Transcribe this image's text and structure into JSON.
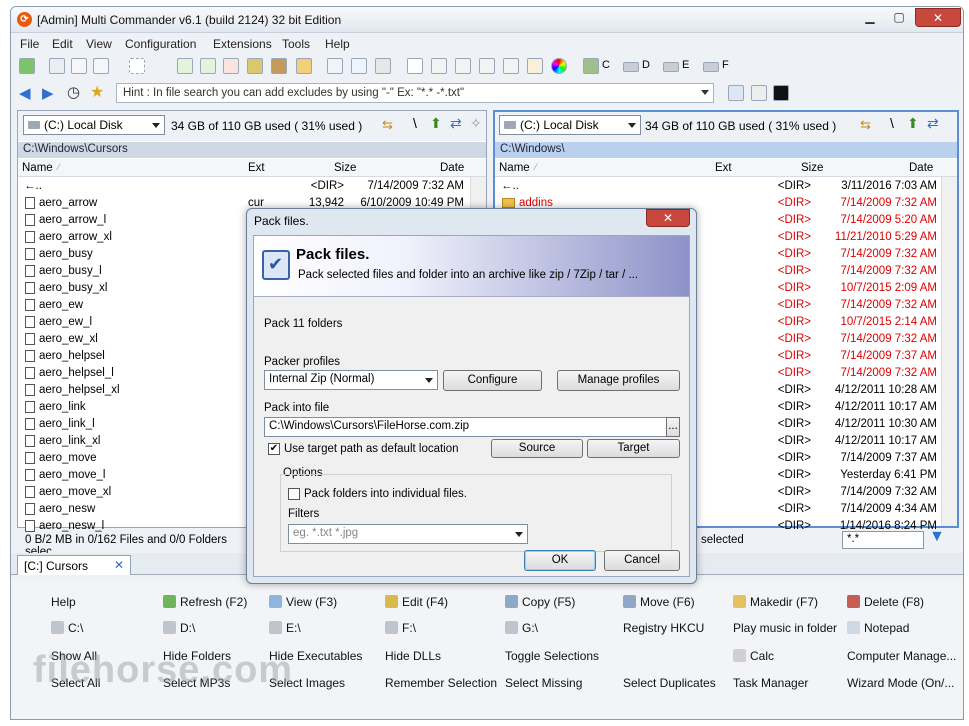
{
  "window": {
    "title": "[Admin] Multi Commander v6.1 (build 2124) 32 bit Edition",
    "app_icon": "multi-commander-icon"
  },
  "menu": [
    "File",
    "Edit",
    "View",
    "Configuration",
    "Extensions",
    "Tools",
    "Help"
  ],
  "toolbar": {
    "drive_labels": [
      "C",
      "D",
      "E",
      "F"
    ]
  },
  "hint": {
    "text": "Hint : In file search you can add excludes by using \"-\" Ex: \"*.* -*.txt\""
  },
  "left_panel": {
    "drive": "(C:) Local Disk",
    "usage": "34 GB of 110 GB used ( 31% used )",
    "path": "C:\\Windows\\Cursors",
    "columns": [
      "Name",
      "Ext",
      "Size",
      "Date"
    ],
    "rows": [
      {
        "name": "←..",
        "ext": "",
        "size": "<DIR>",
        "date": "7/14/2009 7:32 AM"
      },
      {
        "name": "aero_arrow",
        "ext": "cur",
        "size": "13,942",
        "date": "6/10/2009 10:49 PM"
      },
      {
        "name": "aero_arrow_l",
        "ext": "",
        "size": "",
        "date": ""
      },
      {
        "name": "aero_arrow_xl",
        "ext": "",
        "size": "",
        "date": ""
      },
      {
        "name": "aero_busy",
        "ext": "",
        "size": "",
        "date": ""
      },
      {
        "name": "aero_busy_l",
        "ext": "",
        "size": "",
        "date": ""
      },
      {
        "name": "aero_busy_xl",
        "ext": "",
        "size": "",
        "date": ""
      },
      {
        "name": "aero_ew",
        "ext": "",
        "size": "",
        "date": ""
      },
      {
        "name": "aero_ew_l",
        "ext": "",
        "size": "",
        "date": ""
      },
      {
        "name": "aero_ew_xl",
        "ext": "",
        "size": "",
        "date": ""
      },
      {
        "name": "aero_helpsel",
        "ext": "",
        "size": "",
        "date": ""
      },
      {
        "name": "aero_helpsel_l",
        "ext": "",
        "size": "",
        "date": ""
      },
      {
        "name": "aero_helpsel_xl",
        "ext": "",
        "size": "",
        "date": ""
      },
      {
        "name": "aero_link",
        "ext": "",
        "size": "",
        "date": ""
      },
      {
        "name": "aero_link_l",
        "ext": "",
        "size": "",
        "date": ""
      },
      {
        "name": "aero_link_xl",
        "ext": "",
        "size": "",
        "date": ""
      },
      {
        "name": "aero_move",
        "ext": "",
        "size": "",
        "date": ""
      },
      {
        "name": "aero_move_l",
        "ext": "",
        "size": "",
        "date": ""
      },
      {
        "name": "aero_move_xl",
        "ext": "",
        "size": "",
        "date": ""
      },
      {
        "name": "aero_nesw",
        "ext": "",
        "size": "",
        "date": ""
      },
      {
        "name": "aero_nesw_l",
        "ext": "",
        "size": "",
        "date": ""
      }
    ],
    "status": "0 B/2 MB in 0/162 Files and 0/0 Folders selec"
  },
  "right_panel": {
    "drive": "(C:) Local Disk",
    "usage": "34 GB of 110 GB used ( 31% used )",
    "path": "C:\\Windows\\",
    "columns": [
      "Name",
      "Ext",
      "Size",
      "Date"
    ],
    "rows": [
      {
        "name": "←..",
        "size": "<DIR>",
        "date": "3/11/2016 7:03 AM",
        "red": false
      },
      {
        "name": "addins",
        "size": "<DIR>",
        "date": "7/14/2009 7:32 AM",
        "red": true
      },
      {
        "name": "",
        "size": "<DIR>",
        "date": "7/14/2009 5:20 AM",
        "red": true
      },
      {
        "name": "",
        "size": "<DIR>",
        "date": "11/21/2010 5:29 AM",
        "red": true
      },
      {
        "name": "",
        "size": "<DIR>",
        "date": "7/14/2009 7:32 AM",
        "red": true
      },
      {
        "name": "",
        "size": "<DIR>",
        "date": "7/14/2009 7:32 AM",
        "red": true
      },
      {
        "name": "",
        "size": "<DIR>",
        "date": "10/7/2015 2:09 AM",
        "red": true
      },
      {
        "name": "",
        "size": "<DIR>",
        "date": "7/14/2009 7:32 AM",
        "red": true
      },
      {
        "name": "",
        "size": "<DIR>",
        "date": "10/7/2015 2:14 AM",
        "red": true
      },
      {
        "name": "",
        "size": "<DIR>",
        "date": "7/14/2009 7:32 AM",
        "red": true
      },
      {
        "name": "",
        "size": "<DIR>",
        "date": "7/14/2009 7:37 AM",
        "red": true
      },
      {
        "name": "",
        "size": "<DIR>",
        "date": "7/14/2009 7:32 AM",
        "red": true
      },
      {
        "name": "",
        "size": "<DIR>",
        "date": "4/12/2011 10:28 AM",
        "red": false
      },
      {
        "name": "",
        "size": "<DIR>",
        "date": "4/12/2011 10:17 AM",
        "red": false
      },
      {
        "name": "",
        "size": "<DIR>",
        "date": "4/12/2011 10:30 AM",
        "red": false
      },
      {
        "name": "",
        "size": "<DIR>",
        "date": "4/12/2011 10:17 AM",
        "red": false
      },
      {
        "name": "",
        "size": "<DIR>",
        "date": "7/14/2009 7:37 AM",
        "red": false
      },
      {
        "name": "",
        "size": "<DIR>",
        "date": "Yesterday 6:41 PM",
        "red": false
      },
      {
        "name": "",
        "size": "<DIR>",
        "date": "7/14/2009 7:32 AM",
        "red": false
      },
      {
        "name": "",
        "size": "<DIR>",
        "date": "7/14/2009 4:34 AM",
        "red": false
      },
      {
        "name": "",
        "size": "<DIR>",
        "date": "1/14/2016 8:24 PM",
        "red": false
      }
    ],
    "status": "selected",
    "filter": "*.*"
  },
  "tab": {
    "label": "[C:] Cursors",
    "close": "✕"
  },
  "commands": [
    [
      "Help",
      "Refresh (F2)",
      "View (F3)",
      "Edit (F4)",
      "Copy (F5)",
      "Move (F6)",
      "Makedir (F7)",
      "Delete (F8)"
    ],
    [
      "C:\\",
      "D:\\",
      "E:\\",
      "F:\\",
      "G:\\",
      "Registry HKCU",
      "Play music in folder",
      "Notepad"
    ],
    [
      "Show All",
      "Hide Folders",
      "Hide Executables",
      "Hide DLLs",
      "Toggle Selections",
      "",
      "Calc",
      "Computer Manage..."
    ],
    [
      "Select All",
      "Select MP3s",
      "Select Images",
      "Remember Selection",
      "Select Missing",
      "Select Duplicates",
      "Task Manager",
      "Wizard Mode (On/..."
    ]
  ],
  "watermark": "filehorse.com",
  "dialog": {
    "title": "Pack files.",
    "heading": "Pack files.",
    "subheading": "Pack selected files and folder into an archive like zip / 7Zip / tar / ...",
    "summary": "Pack 11 folders",
    "profiles_label": "Packer profiles",
    "profile_value": "Internal Zip (Normal)",
    "configure": "Configure",
    "manage": "Manage profiles",
    "pack_into_label": "Pack into file",
    "pack_into_value": "C:\\Windows\\Cursors\\FileHorse.com.zip",
    "browse": "...",
    "use_target_label": "Use target path as default location",
    "source": "Source",
    "target": "Target",
    "options_label": "Options",
    "individual_label": "Pack folders into individual files.",
    "filters_label": "Filters",
    "filters_placeholder": "eg. *.txt *.jpg",
    "ok": "OK",
    "cancel": "Cancel"
  }
}
